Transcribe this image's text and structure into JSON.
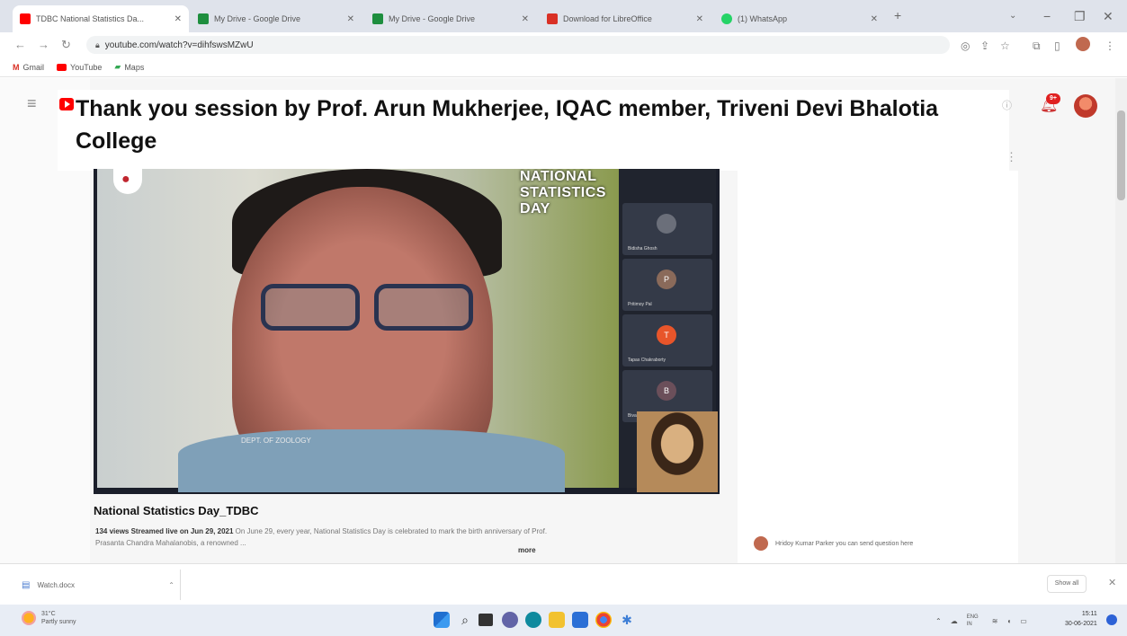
{
  "browser": {
    "tabs": [
      {
        "title": "TDBC National Statistics Da...",
        "favicon_color": "#ff0000",
        "active": true
      },
      {
        "title": "My Drive - Google Drive",
        "favicon_color": "#1e8e3e",
        "active": false
      },
      {
        "title": "My Drive - Google Drive",
        "favicon_color": "#1e8e3e",
        "active": false
      },
      {
        "title": "Download for LibreOffice",
        "favicon_color": "#d93025",
        "active": false
      },
      {
        "title": "(1) WhatsApp",
        "favicon_color": "#25d366",
        "active": false
      }
    ],
    "new_tab_label": "+",
    "address": "youtube.com/watch?v=dihfswsMZwU",
    "bookmarks": [
      {
        "label": "Gmail",
        "icon": "gmail-icon",
        "color": "#d93025"
      },
      {
        "label": "YouTube",
        "icon": "youtube-icon",
        "color": "#ff0000"
      },
      {
        "label": "Maps",
        "icon": "maps-icon",
        "color": "#34a853"
      }
    ]
  },
  "youtube": {
    "page_heading": "Thank you session by Prof. Arun Mukherjee, IQAC member, Triveni Devi Bhalotia College",
    "notification_count": "9+",
    "video": {
      "overlay_title": "NATIONAL STATISTICS DAY",
      "overlay_subtitle": "DEPT. OF ZOOLOGY",
      "participants": [
        {
          "name": "Bidisha Ghosh",
          "initial": "",
          "color": "#6b6f7a"
        },
        {
          "name": "Pritimoy Pal",
          "initial": "P",
          "color": "#8a6a5a"
        },
        {
          "name": "Tapas Chakraborty",
          "initial": "T",
          "color": "#e8552a"
        },
        {
          "name": "Biva Dutta",
          "initial": "B",
          "color": "#6b4f5a"
        }
      ]
    },
    "video_title": "National Statistics Day_TDBC",
    "views_line": "134 views  Streamed live on Jun 29, 2021",
    "description": "On June 29, every year, National Statistics Day is celebrated to mark the birth anniversary of Prof. Prasanta Chandra Mahalanobis, a renowned ...",
    "more_label": "more",
    "chat_message": "Hridoy Kumar Parker   you can send question here"
  },
  "downloads": {
    "item_label": "Watch.docx",
    "show_all": "Show all"
  },
  "taskbar": {
    "weather_temp": "31°C",
    "weather_desc": "Partly sunny",
    "lang": "ENG IN",
    "time": "15:11",
    "date": "30-06-2021"
  }
}
